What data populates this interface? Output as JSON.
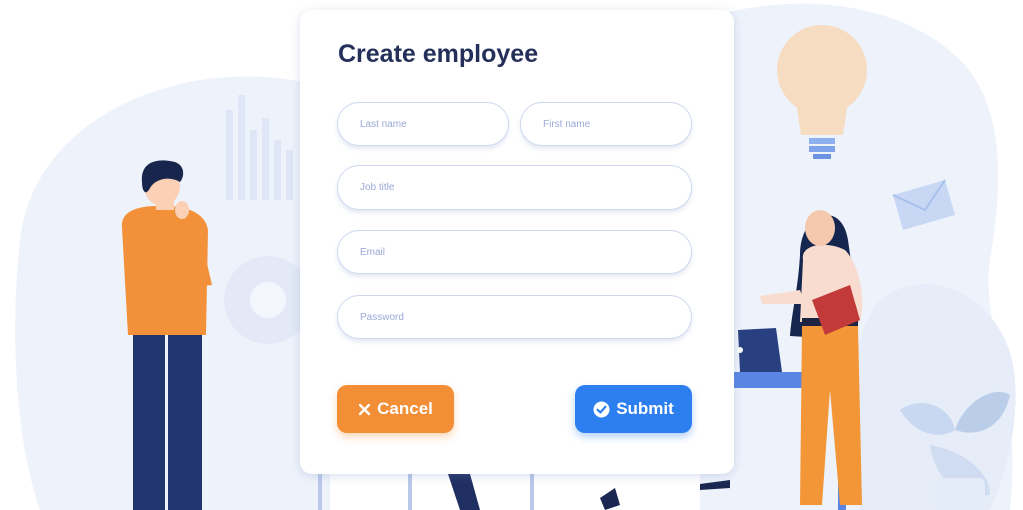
{
  "form": {
    "title": "Create employee",
    "fields": {
      "last_name": {
        "placeholder": "Last name",
        "value": ""
      },
      "first_name": {
        "placeholder": "First name",
        "value": ""
      },
      "job_title": {
        "placeholder": "Job title",
        "value": ""
      },
      "email": {
        "placeholder": "Email",
        "value": ""
      },
      "password": {
        "placeholder": "Password",
        "value": ""
      }
    },
    "buttons": {
      "cancel_label": "Cancel",
      "cancel_icon": "close-icon",
      "submit_label": "Submit",
      "submit_icon": "check-circle-icon"
    }
  },
  "colors": {
    "title": "#25305a",
    "field_border": "#cfd8f0",
    "placeholder": "#9aa8d6",
    "cancel": "#f28e35",
    "submit": "#2d7ff0",
    "background_blob": "#eef3fb"
  }
}
